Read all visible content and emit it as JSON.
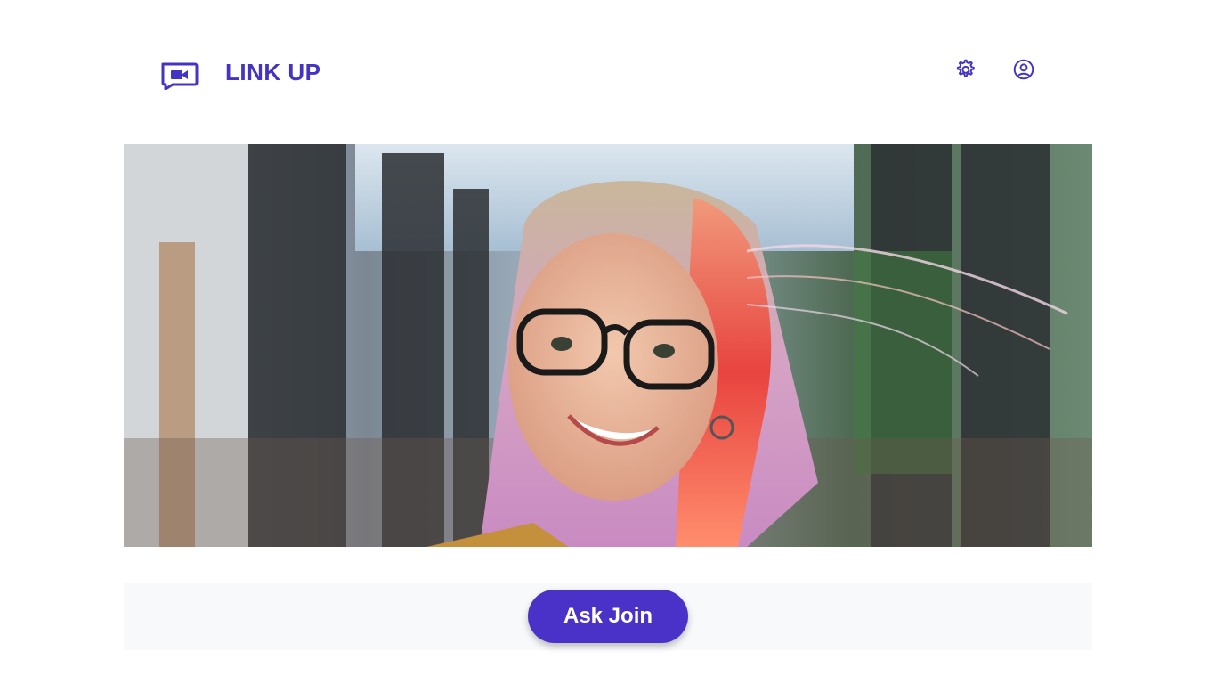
{
  "app": {
    "title": "LINK UP",
    "logo_icon": "video-chat-icon",
    "accent_color": "#4434c4"
  },
  "header": {
    "settings_icon": "gear-icon",
    "profile_icon": "user-circle-icon"
  },
  "video": {
    "preview": "camera-preview"
  },
  "controls": {
    "ask_join_label": "Ask Join",
    "button_color": "#4a32c9"
  }
}
